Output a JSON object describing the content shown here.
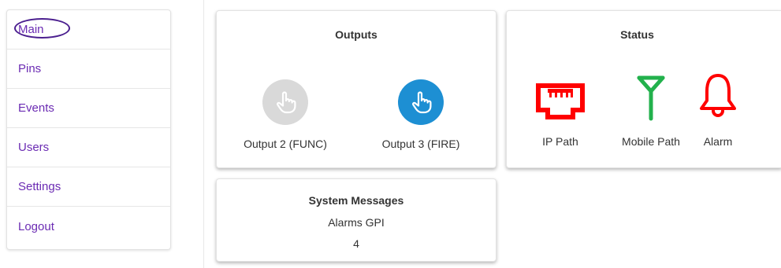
{
  "sidebar": {
    "items": [
      {
        "label": "Main",
        "active": true
      },
      {
        "label": "Pins"
      },
      {
        "label": "Events"
      },
      {
        "label": "Users"
      },
      {
        "label": "Settings"
      },
      {
        "label": "Logout"
      }
    ]
  },
  "outputs": {
    "title": "Outputs",
    "items": [
      {
        "label": "Output 2 (FUNC)",
        "icon": "pointing-hand-icon",
        "state": "inactive",
        "color": "#d9d9d9"
      },
      {
        "label": "Output 3 (FIRE)",
        "icon": "pointing-hand-icon",
        "state": "active",
        "color": "#1d8fd3"
      }
    ]
  },
  "status": {
    "title": "Status",
    "items": [
      {
        "label": "IP Path",
        "icon": "ethernet-port-icon",
        "color": "#ff0000"
      },
      {
        "label": "Mobile Path",
        "icon": "antenna-icon",
        "color": "#22b14c"
      },
      {
        "label": "Alarm",
        "icon": "bell-icon",
        "color": "#ff0000"
      }
    ]
  },
  "system_messages": {
    "title": "System Messages",
    "subtitle": "Alarms GPI",
    "count": "4"
  },
  "colors": {
    "nav_text": "#6b2bb3",
    "active_ring": "#4b1f8f"
  }
}
